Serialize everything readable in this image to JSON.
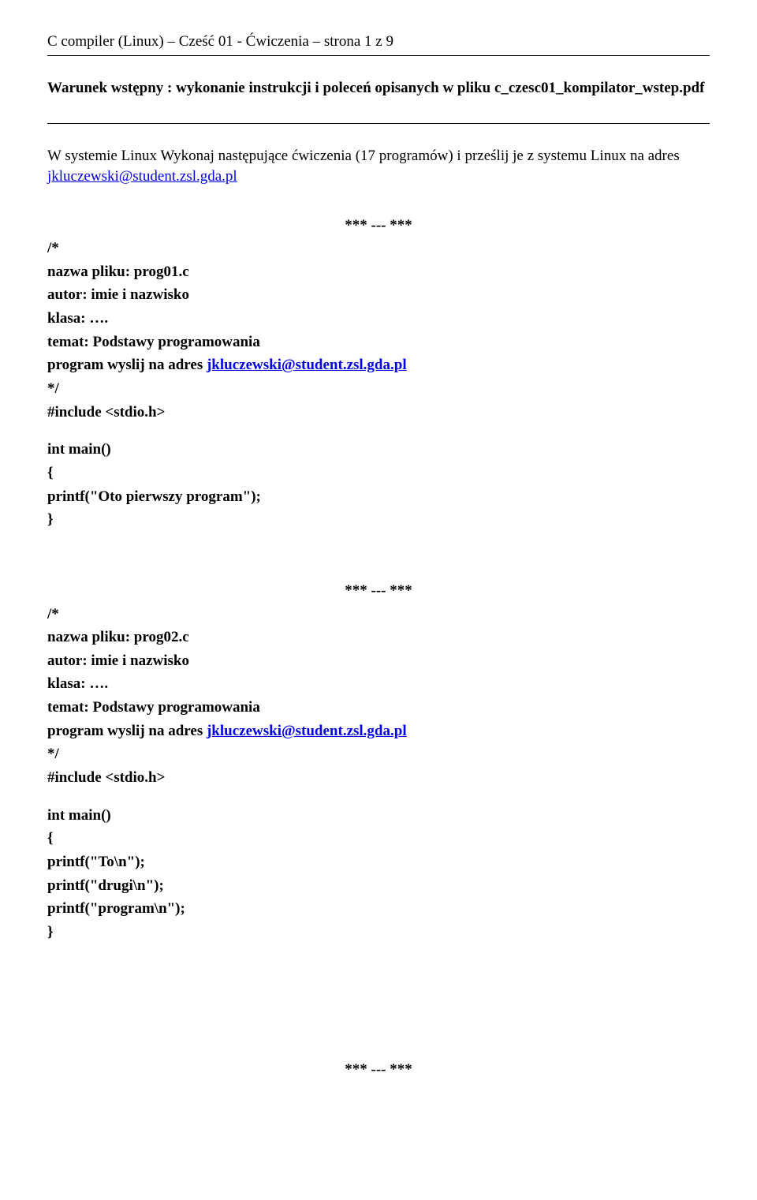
{
  "header": "C compiler (Linux) – Cześć 01 - Ćwiczenia – strona 1 z 9",
  "intro": {
    "bold_lead": "Warunek wstępny : wykonanie instrukcji i poleceń opisanych w pliku c_czesc01_kompilator_wstep.pdf"
  },
  "paragraph2": {
    "pre": "W systemie Linux Wykonaj następujące ćwiczenia (17 programów) i prześlij je z systemu Linux na adres ",
    "email": "jkluczewski@student.zsl.gda.pl"
  },
  "sep": "*** --- ***",
  "block1": {
    "l1": "/*",
    "l2": "nazwa pliku: prog01.c",
    "l3": "autor: imie i nazwisko",
    "l4": "klasa: ….",
    "l5": "temat: Podstawy programowania",
    "l6_pre": "program wyslij na adres ",
    "l6_email": "jkluczewski@student.zsl.gda.pl",
    "l7": "*/",
    "l8": "#include <stdio.h>",
    "l9": "int main()",
    "l10": "{",
    "l11": "printf(\"Oto pierwszy program\");",
    "l12": "}"
  },
  "block2": {
    "l1": "/*",
    "l2": "nazwa pliku: prog02.c",
    "l3": "autor: imie i nazwisko",
    "l4": "klasa: ….",
    "l5": "temat: Podstawy programowania",
    "l6_pre": "program wyslij na adres ",
    "l6_email": "jkluczewski@student.zsl.gda.pl",
    "l7": "*/",
    "l8": "#include <stdio.h>",
    "l9": "int main()",
    "l10": "{",
    "l11": "printf(\"To\\n\");",
    "l12": "printf(\"drugi\\n\");",
    "l13": "printf(\"program\\n\");",
    "l14": "}"
  }
}
